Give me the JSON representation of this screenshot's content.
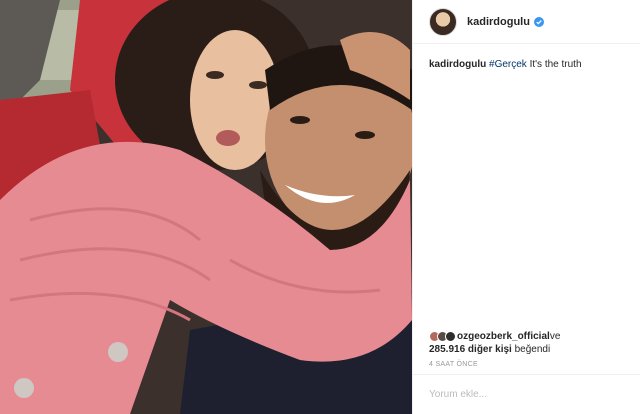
{
  "header": {
    "username": "kadirdogulu",
    "verified_icon": "verified-badge-icon",
    "verified_color": "#3897f0"
  },
  "caption": {
    "username": "kadirdogulu",
    "hashtag": "#Gerçek",
    "text": " It's the truth"
  },
  "likes": {
    "first_liker": "ozgeozberk_official",
    "connector": " ve",
    "count_text": "285.916 diğer kişi",
    "suffix": " beğendi"
  },
  "timestamp": "4 SAAT ÖNCE",
  "comment": {
    "placeholder": "Yorum ekle..."
  },
  "colors": {
    "accent_link": "#003569",
    "border": "#efefef",
    "secondary_text": "#999999"
  },
  "photo": {
    "description_icon": "photo-image"
  }
}
